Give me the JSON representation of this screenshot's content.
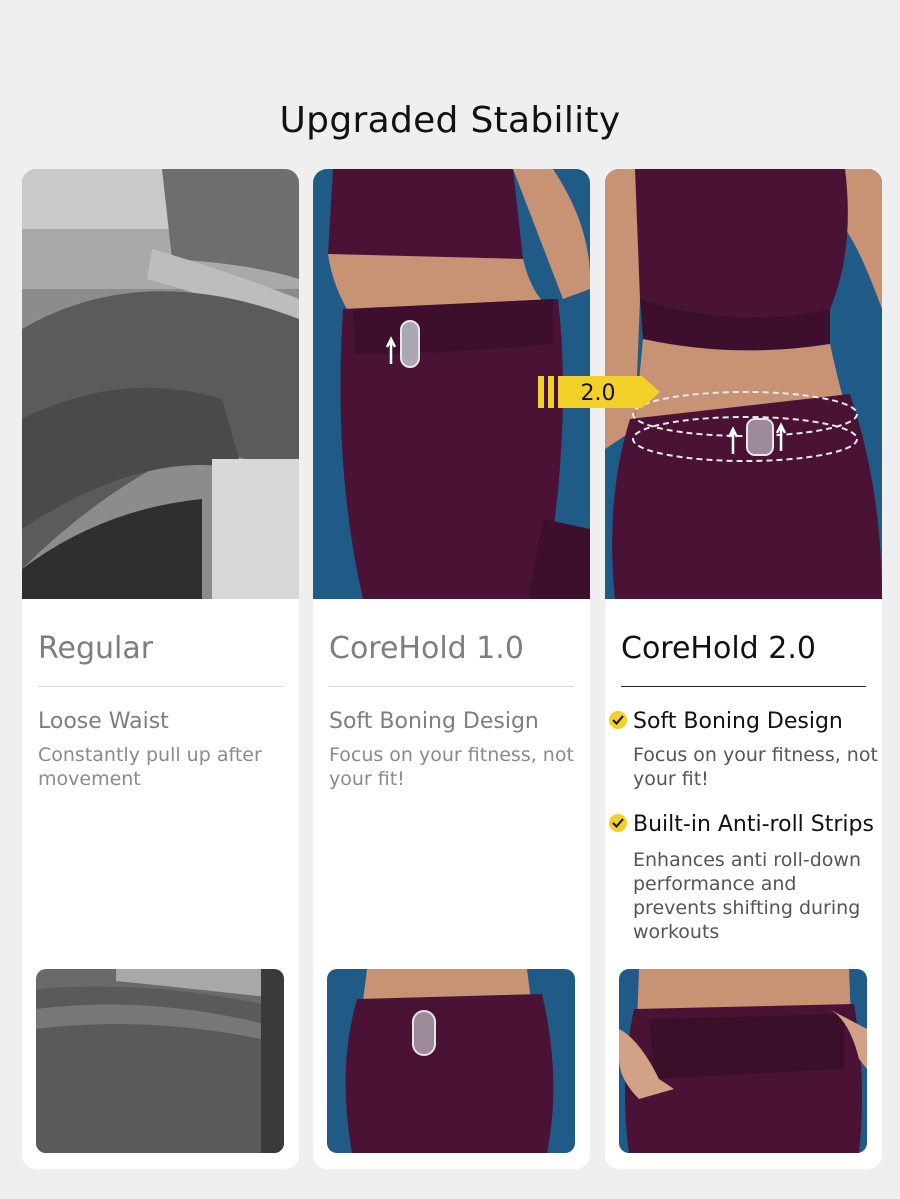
{
  "title": "Upgraded Stability",
  "badge_label": "2.0",
  "colors": {
    "accent_yellow": "#f3cf2a",
    "legging_purple": "#4a1335",
    "court_blue": "#1f5b86"
  },
  "cards": [
    {
      "heading": "Regular",
      "subheading": "Loose Waist",
      "description": "Constantly pull up after movement"
    },
    {
      "heading": "CoreHold 1.0",
      "subheading": "Soft Boning Design",
      "description": "Focus on your fitness, not your fit!"
    },
    {
      "heading": "CoreHold 2.0",
      "features": [
        {
          "icon": "check-icon",
          "title": "Soft Boning Design",
          "description": "Focus on your fitness, not your fit!"
        },
        {
          "icon": "check-icon",
          "title": "Built-in Anti-roll Strips",
          "description": "Enhances anti roll-down performance and prevents shifting during workouts"
        }
      ]
    }
  ]
}
